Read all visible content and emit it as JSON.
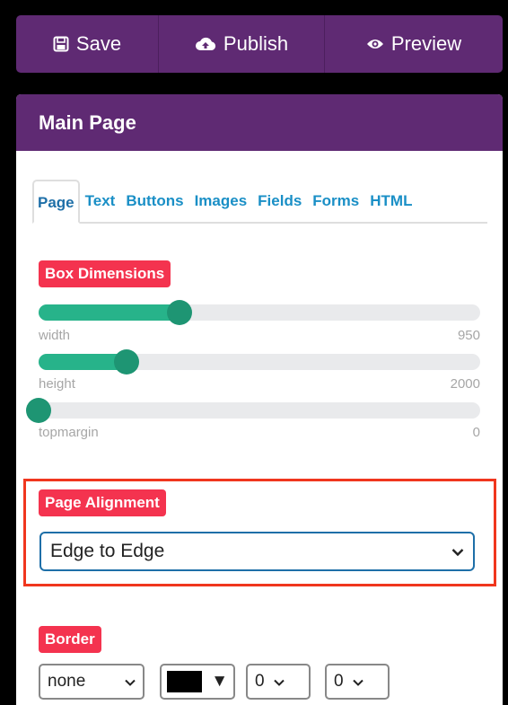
{
  "toolbar": {
    "save_label": "Save",
    "publish_label": "Publish",
    "preview_label": "Preview"
  },
  "panel": {
    "title": "Main Page",
    "tabs": [
      {
        "label": "Page",
        "active": true
      },
      {
        "label": "Text"
      },
      {
        "label": "Buttons"
      },
      {
        "label": "Images"
      },
      {
        "label": "Fields"
      },
      {
        "label": "Forms"
      },
      {
        "label": "HTML"
      }
    ]
  },
  "box_dimensions": {
    "heading": "Box Dimensions",
    "sliders": [
      {
        "label": "width",
        "value": "950",
        "fraction": 0.32
      },
      {
        "label": "height",
        "value": "2000",
        "fraction": 0.2
      },
      {
        "label": "topmargin",
        "value": "0",
        "fraction": 0.0
      }
    ]
  },
  "page_alignment": {
    "heading": "Page Alignment",
    "selected": "Edge to Edge"
  },
  "border": {
    "heading": "Border",
    "style": "none",
    "color": "#000000",
    "width": "0",
    "radius": "0"
  },
  "colors": {
    "accent": "#5f2a73",
    "badge": "#f4334f",
    "slider_fill": "#27b38a",
    "tab_text": "#1a8fc6"
  }
}
